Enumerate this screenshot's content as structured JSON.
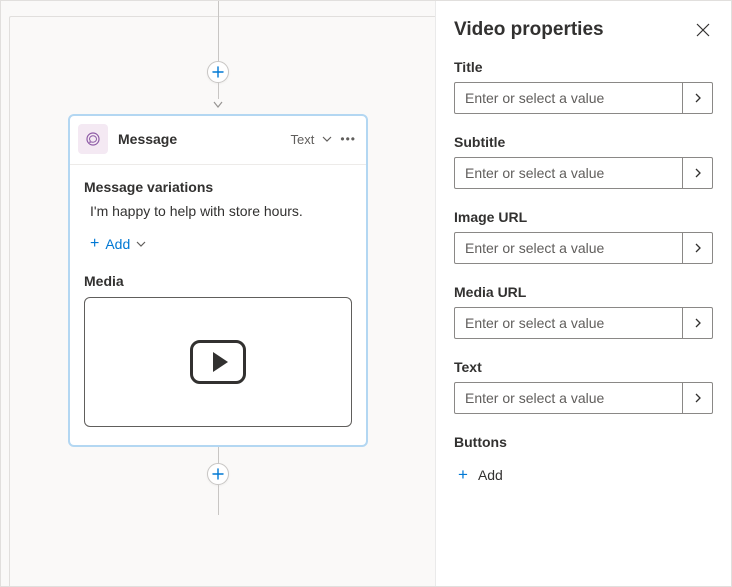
{
  "canvas": {
    "card": {
      "title": "Message",
      "type_label": "Text",
      "variations_label": "Message variations",
      "variation_text": "I'm happy to help with store hours.",
      "add_label": "Add",
      "media_label": "Media"
    }
  },
  "panel": {
    "title": "Video properties",
    "fields": {
      "title": {
        "label": "Title",
        "placeholder": "Enter or select a value"
      },
      "subtitle": {
        "label": "Subtitle",
        "placeholder": "Enter or select a value"
      },
      "image_url": {
        "label": "Image URL",
        "placeholder": "Enter or select a value"
      },
      "media_url": {
        "label": "Media URL",
        "placeholder": "Enter or select a value"
      },
      "text": {
        "label": "Text",
        "placeholder": "Enter or select a value"
      }
    },
    "buttons_label": "Buttons",
    "add_label": "Add"
  },
  "colors": {
    "accent": "#0078d4",
    "card_border": "#b3d7f2",
    "icon_bg": "#f4e9f3"
  }
}
